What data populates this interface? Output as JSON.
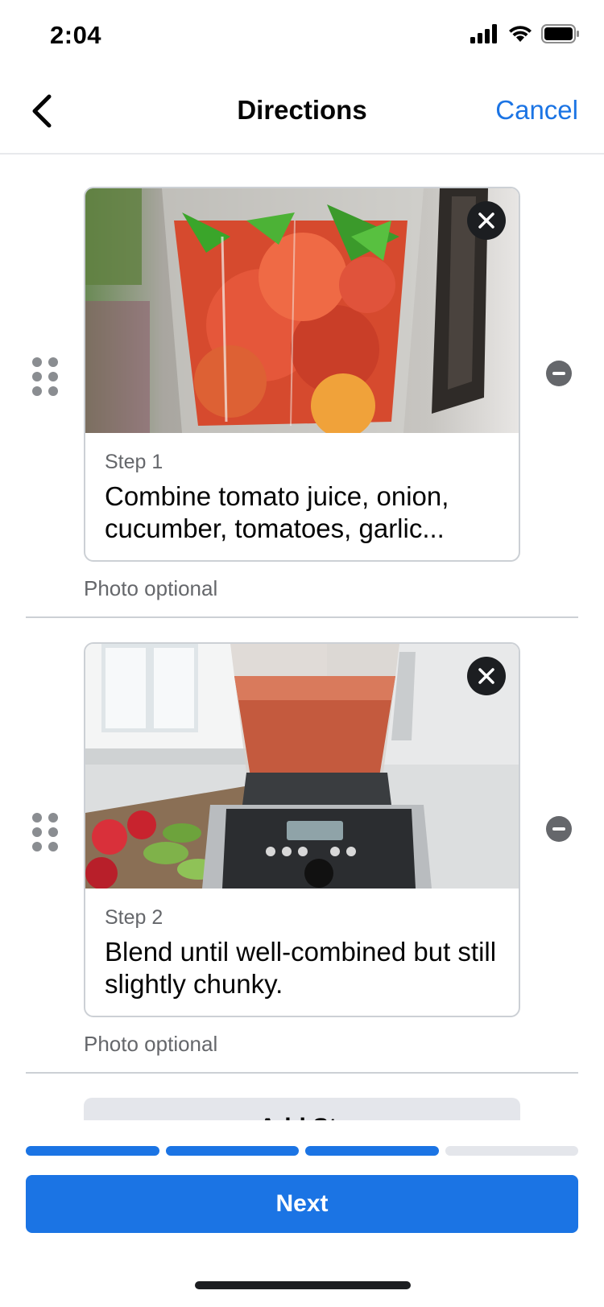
{
  "status_bar": {
    "time": "2:04",
    "icons": [
      "cellular-signal-icon",
      "wifi-icon",
      "battery-icon"
    ]
  },
  "nav": {
    "back_icon": "chevron-left-icon",
    "title": "Directions",
    "cancel_label": "Cancel"
  },
  "steps": [
    {
      "label": "Step 1",
      "description": "Combine tomato juice, onion, cucumber, tomatoes, garlic...",
      "photo_note": "Photo optional",
      "photo_close_icon": "close-icon",
      "drag_icon": "drag-handle-icon",
      "remove_icon": "remove-circle-icon"
    },
    {
      "label": "Step 2",
      "description": "Blend until well-combined but still slightly chunky.",
      "photo_note": "Photo optional",
      "photo_close_icon": "close-icon",
      "drag_icon": "drag-handle-icon",
      "remove_icon": "remove-circle-icon"
    }
  ],
  "add_step_label": "+ Add Step",
  "progress": {
    "total_segments": 4,
    "completed_segments": 3
  },
  "next_label": "Next",
  "colors": {
    "accent": "#1b74e4",
    "text_primary": "#050505",
    "text_secondary": "#65676b",
    "divider": "#ccd0d5",
    "inactive": "#e4e6eb"
  }
}
